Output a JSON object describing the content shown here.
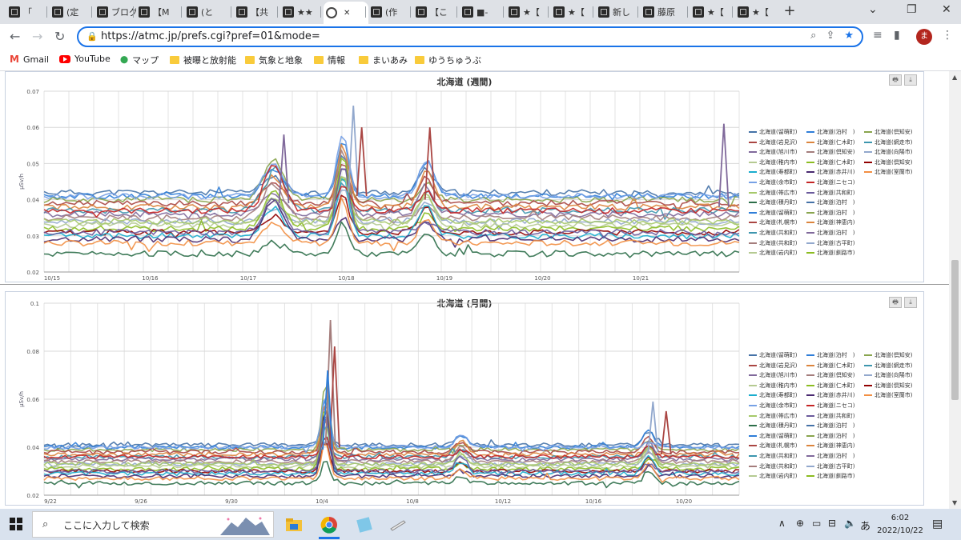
{
  "browser": {
    "tabs": [
      {
        "label": "「"
      },
      {
        "label": "(定"
      },
      {
        "label": "ブログ"
      },
      {
        "label": "【M"
      },
      {
        "label": "(と"
      },
      {
        "label": "【共"
      },
      {
        "label": "★★"
      },
      {
        "label": "",
        "active": true
      },
      {
        "label": "(作"
      },
      {
        "label": "【こ"
      },
      {
        "label": "■-"
      },
      {
        "label": "★【"
      },
      {
        "label": "★【"
      },
      {
        "label": "新し"
      },
      {
        "label": "藤原"
      },
      {
        "label": "★【"
      },
      {
        "label": "★【"
      }
    ],
    "new_tab": "+",
    "window_controls": {
      "minimize": "⌄",
      "restore": "❐",
      "close": "✕"
    },
    "url": "https://atmc.jp/prefs.cgi?pref=01&mode=",
    "profile_initial": "ま"
  },
  "bookmarks": [
    {
      "label": "Gmail",
      "icon": "gmail-icon"
    },
    {
      "label": "YouTube",
      "icon": "youtube-icon"
    },
    {
      "label": "マップ",
      "icon": "maps-icon"
    },
    {
      "label": "被曝と放射能",
      "icon": "folder-icon"
    },
    {
      "label": "気象と地象",
      "icon": "folder-icon"
    },
    {
      "label": "情報",
      "icon": "folder-icon"
    },
    {
      "label": "まいあみ",
      "icon": "folder-icon"
    },
    {
      "label": "ゆうちゅうぶ",
      "icon": "folder-icon"
    }
  ],
  "legend_labels": [
    "北海道(留萌町)",
    "北海道(泊村　)",
    "北海道(倶知安)",
    "北海道(岩見沢)",
    "北海道(仁木町)",
    "北海道(網走市)",
    "北海道(旭川市)",
    "北海道(倶知安)",
    "北海道(向陽市)",
    "北海道(稚内市)",
    "北海道(仁木町)",
    "北海道(倶知安)",
    "北海道(寿都町)",
    "北海道(赤井川)",
    "北海道(室蘭市)",
    "北海道(余市町)",
    "北海道(ニセコ)",
    "北海道(帯広市)",
    "北海道(共和町)",
    "北海道(積丹町)",
    "北海道(泊村　)",
    "北海道(留萌町)",
    "北海道(泊村　)",
    "北海道(札幌市)",
    "北海道(神恵内)",
    "北海道(共和町)",
    "北海道(泊村　)",
    "北海道(共和町)",
    "北海道(古平町)",
    "北海道(岩内町)",
    "北海道(釧路市)"
  ],
  "series_colors": [
    "#4572a7",
    "#2f7ed8",
    "#89a54e",
    "#aa4643",
    "#db843d",
    "#3d96ae",
    "#80699b",
    "#a47d7c",
    "#92a8cd",
    "#b5ca92",
    "#8bbc21",
    "#910000",
    "#1aadce",
    "#492970",
    "#f28f43",
    "#77a1e5",
    "#c42525",
    "#a6c96a",
    "#6a5a9c",
    "#2c6e49"
  ],
  "chart_data": [
    {
      "type": "line",
      "title": "北海道 (週間)",
      "ylabel": "μSv/h",
      "ylim": [
        0.02,
        0.07
      ],
      "yticks": [
        "0.07",
        "0.06",
        "0.05",
        "0.04",
        "0.03",
        "0.02"
      ],
      "xticks": [
        "10/15",
        "10/16",
        "10/17",
        "10/18",
        "10/19",
        "10/20",
        "10/21"
      ],
      "n_points": 160,
      "notable_peaks": [
        {
          "x": "10/18",
          "value": 0.066
        },
        {
          "x": "10/18",
          "value": 0.06
        },
        {
          "x": "10/18 late",
          "value": 0.06
        },
        {
          "x": "10/17 late",
          "value": 0.058
        },
        {
          "x": "10/21 late",
          "value": 0.061
        }
      ],
      "series_levels": [
        0.042,
        0.041,
        0.04,
        0.039,
        0.038,
        0.037,
        0.036,
        0.035,
        0.034,
        0.033,
        0.032,
        0.031,
        0.03,
        0.029,
        0.028,
        0.041,
        0.037,
        0.034,
        0.031,
        0.025
      ]
    },
    {
      "type": "line",
      "title": "北海道 (月間)",
      "ylabel": "μSv/h",
      "ylim": [
        0.02,
        0.1
      ],
      "yticks": [
        "0.1",
        "0.08",
        "0.06",
        "0.04",
        "0.02"
      ],
      "xticks": [
        "9/22",
        "9/26",
        "9/30",
        "10/4",
        "10/8",
        "10/12",
        "10/16",
        "10/20"
      ],
      "n_points": 200,
      "notable_peaks": [
        {
          "x": "10/4",
          "value": 0.093
        },
        {
          "x": "10/4",
          "value": 0.082
        },
        {
          "x": "10/4",
          "value": 0.072
        },
        {
          "x": "10/18",
          "value": 0.059
        },
        {
          "x": "10/18",
          "value": 0.055
        }
      ],
      "series_levels": [
        0.041,
        0.04,
        0.039,
        0.038,
        0.037,
        0.036,
        0.035,
        0.034,
        0.033,
        0.032,
        0.031,
        0.03,
        0.029,
        0.028,
        0.027,
        0.04,
        0.036,
        0.033,
        0.03,
        0.025
      ]
    }
  ],
  "panel_buttons": {
    "print": "🖶",
    "download": "⤓"
  },
  "taskbar": {
    "search_placeholder": "ここに入力して検索",
    "ime": "あ",
    "time": "6:02",
    "date": "2022/10/22"
  }
}
